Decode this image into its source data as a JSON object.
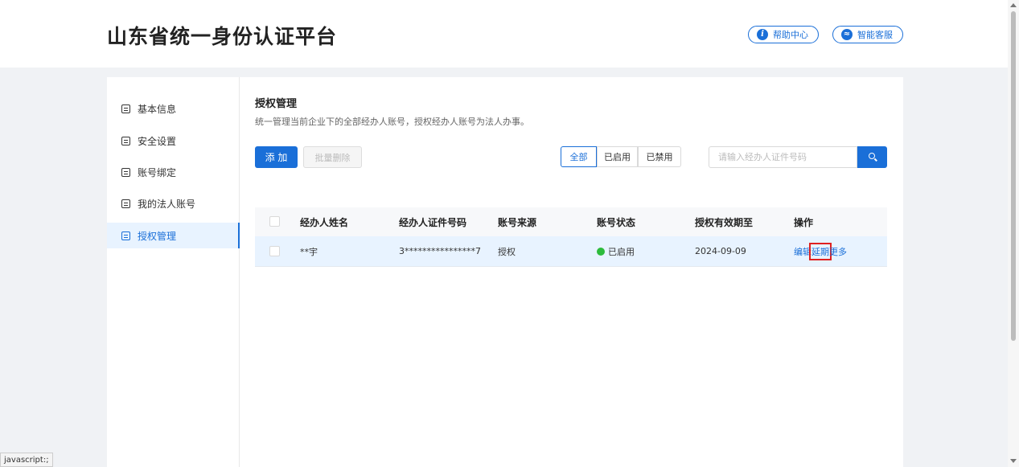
{
  "header": {
    "title": "山东省统一身份认证平台",
    "help_label": "帮助中心",
    "service_label": "智能客服"
  },
  "sidebar": {
    "items": [
      {
        "label": "基本信息"
      },
      {
        "label": "安全设置"
      },
      {
        "label": "账号绑定"
      },
      {
        "label": "我的法人账号"
      },
      {
        "label": "授权管理"
      }
    ]
  },
  "main": {
    "title": "授权管理",
    "description": "统一管理当前企业下的全部经办人账号，授权经办人账号为法人办事。",
    "add_label": "添 加",
    "batch_delete_label": "批量删除",
    "filters": [
      "全部",
      "已启用",
      "已禁用"
    ],
    "search_placeholder": "请输入经办人证件号码"
  },
  "table": {
    "columns": [
      "经办人姓名",
      "经办人证件号码",
      "账号来源",
      "账号状态",
      "授权有效期至",
      "操作"
    ],
    "rows": [
      {
        "name": "**宇",
        "id_number": "3****************7",
        "source": "授权",
        "status": "已启用",
        "expiry": "2024-09-09",
        "actions": [
          "编辑",
          "延期",
          "更多"
        ]
      }
    ]
  },
  "statusbar": {
    "text": "javascript:;"
  },
  "colors": {
    "accent": "#1a6fd8",
    "status_on": "#2dbb3c",
    "highlight_box": "#e02020"
  }
}
